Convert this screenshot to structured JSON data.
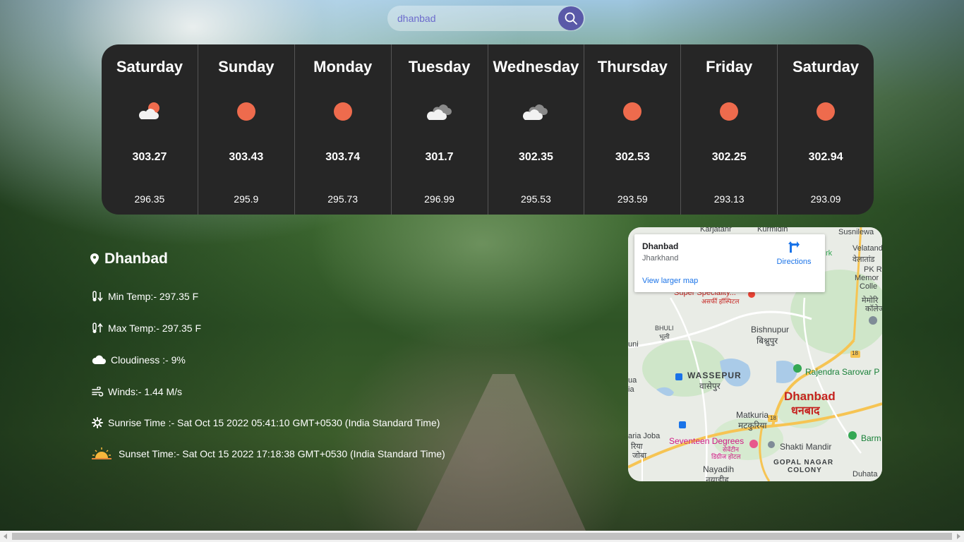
{
  "search": {
    "value": "dhanbad"
  },
  "forecast": [
    {
      "day": "Saturday",
      "icon": "partly-cloudy-sun-icon",
      "max": "303.27",
      "min": "296.35"
    },
    {
      "day": "Sunday",
      "icon": "sun-icon",
      "max": "303.43",
      "min": "295.9"
    },
    {
      "day": "Monday",
      "icon": "sun-icon",
      "max": "303.74",
      "min": "295.73"
    },
    {
      "day": "Tuesday",
      "icon": "clouds-icon",
      "max": "301.7",
      "min": "296.99"
    },
    {
      "day": "Wednesday",
      "icon": "clouds-icon",
      "max": "302.35",
      "min": "295.53"
    },
    {
      "day": "Thursday",
      "icon": "sun-icon",
      "max": "302.53",
      "min": "293.59"
    },
    {
      "day": "Friday",
      "icon": "sun-icon",
      "max": "302.25",
      "min": "293.13"
    },
    {
      "day": "Saturday",
      "icon": "sun-icon",
      "max": "302.94",
      "min": "293.09"
    }
  ],
  "current": {
    "city": "Dhanbad",
    "min_temp": "Min Temp:- 297.35 F",
    "max_temp": "Max Temp:- 297.35 F",
    "cloudiness": "Cloudiness :- 9%",
    "winds": "Winds:- 1.44 M/s",
    "sunrise": "Sunrise Time :- Sat Oct 15 2022 05:41:10 GMT+0530 (India Standard Time)",
    "sunset": "Sunset Time:- Sat Oct 15 2022 17:18:38 GMT+0530 (India Standard Time)"
  },
  "map": {
    "place": "Dhanbad",
    "region": "Jharkhand",
    "directions": "Directions",
    "larger": "View larger map",
    "labels": {
      "karjatanr": "Karjatanr",
      "kurmidih": "Kurmidih",
      "susnilewa": "Susnilewa",
      "velatand": "Velatand",
      "velatand_hi": "वेलातांड",
      "pk_roy": "PK Ro",
      "memorial": "Memor",
      "college": "Colle",
      "hindi_memorial": "मेमोरि",
      "hindi_college": "कॉलेज",
      "k": "rk",
      "super": "Super Speciality...",
      "super_hi": "असर्फी हॉस्पिटल",
      "bhuli": "BHULI",
      "bhuli_hi": "भूली",
      "bishnupur": "Bishnupur",
      "bishnupur_hi": "बिश्नुपुर",
      "uni": "uni",
      "wassepur": "WASSEPUR",
      "wassepur_hi": "वासेपुर",
      "rajendra": "Rajendra Sarovar P",
      "dhanbad": "Dhanbad",
      "dhanbad_hi": "धनबाद",
      "matkuria": "Matkuria",
      "matkuria_hi": "मटकुरिया",
      "ua": "ua",
      "ia": "ia",
      "joba": "aria Joba",
      "joba_hi1": "रिया",
      "joba_hi2": "जोबा",
      "seventeen": "Seventeen Degrees",
      "seventeen_hi1": "सेवेंटीन",
      "seventeen_hi2": "डिग्रीज होटल",
      "shakti": "Shakti Mandir",
      "barm": "Barm",
      "gopal": "GOPAL NAGAR",
      "colony": "COLONY",
      "nayadih": "Nayadih",
      "nayadih_hi": "नयाडीह",
      "duhata": "Duhata",
      "r18a": "18",
      "r18b": "18"
    }
  }
}
